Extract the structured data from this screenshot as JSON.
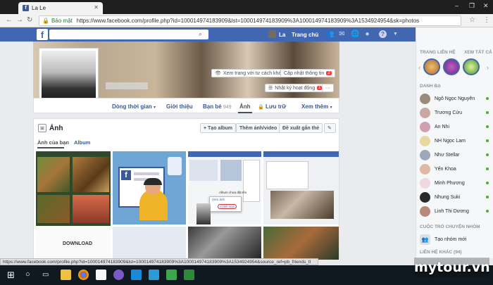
{
  "browser": {
    "tab_title": "La Le",
    "user_chip": "Bảo mật",
    "secure_label": "Bảo mật",
    "url": "https://www.facebook.com/profile.php?id=100014974183909&lst=100014974183909%3A100014974183909%3A1534924954&sk=photos",
    "status_url": "https://www.facebook.com/profile.php?id=100014974183909&lst=100014974183909%3A100014974183909%3A1534924954&source_ref=pb_friends_tl"
  },
  "fb_header": {
    "logo": "f",
    "user_name": "La",
    "home_label": "Trang chủ",
    "help_label": "?"
  },
  "cover": {
    "view_as_button": "Xem trang với tư cách khác",
    "update_info_button": "Cập nhật thông tin",
    "update_info_badge": "2",
    "activity_log_button": "Nhật ký hoạt động",
    "activity_log_badge": "1",
    "more_button": "···"
  },
  "profile_tabs": {
    "timeline": "Dòng thời gian",
    "about": "Giới thiệu",
    "friends": "Bạn bè",
    "friends_count": "949",
    "photos": "Ảnh",
    "archive": "Lưu trữ",
    "more": "Xem thêm"
  },
  "photos_section": {
    "title": "Ảnh",
    "create_album": "+ Tạo album",
    "add_photo": "Thêm ảnh/video",
    "suggest_tags": "Đề xuất gắn thẻ",
    "tab_photos_of_you": "Ảnh của bạn",
    "tab_albums": "Album",
    "popup_album": "Album chưa đặt tên",
    "popup_item_1": "Xem ảnh",
    "popup_item_2": "Chỉnh sửa",
    "download_label": "DOWNLOAD"
  },
  "sidebar": {
    "stories_header": "TRANG LIÊN HỆ",
    "see_all": "XEM TẤT CẢ",
    "contacts_header": "DANH BẠ",
    "contacts": [
      {
        "name": "Ngô Ngọc Nguyên"
      },
      {
        "name": "Trương Cửu"
      },
      {
        "name": "An Nhi"
      },
      {
        "name": "NH Ngọc Lam"
      },
      {
        "name": "Như Stellar"
      },
      {
        "name": "Yến Khoa"
      },
      {
        "name": "Minh Phương"
      },
      {
        "name": "Nhung Suki"
      },
      {
        "name": "Linh Thi Dương"
      }
    ],
    "group_header": "CUỘC TRÒ CHUYỆN NHÓM",
    "new_group": "Tạo nhóm mới",
    "more_contacts_header": "LIÊN HỆ KHÁC (94)"
  },
  "taskbar": {
    "icons": [
      "windows-start",
      "search",
      "task-view",
      "file-explorer",
      "chrome",
      "sticky-notes",
      "viber",
      "blue-app",
      "paint",
      "camtasia",
      "camtasia-2"
    ]
  },
  "watermark": "mytour.vn",
  "colors": {
    "fb_blue": "#4267b2",
    "online_green": "#42b72a",
    "badge_red": "#fa3e3e"
  }
}
